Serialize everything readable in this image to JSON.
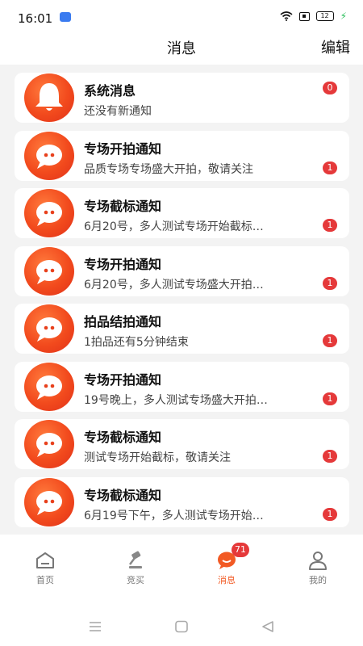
{
  "status": {
    "time": "16:01",
    "battery": "12"
  },
  "header": {
    "title": "消息",
    "edit": "编辑"
  },
  "messages": [
    {
      "title": "系统消息",
      "sub": "还没有新通知",
      "badge": "0",
      "icon": "bell-icon"
    },
    {
      "title": "专场开拍通知",
      "sub": "品质专场专场盛大开拍，敬请关注",
      "badge": "1",
      "icon": "chat-bubble-icon"
    },
    {
      "title": "专场截标通知",
      "sub": "6月20号，多人测试专场开始截标…",
      "badge": "1",
      "icon": "chat-bubble-icon"
    },
    {
      "title": "专场开拍通知",
      "sub": "6月20号，多人测试专场盛大开拍…",
      "badge": "1",
      "icon": "chat-bubble-icon"
    },
    {
      "title": "拍品结拍通知",
      "sub": "1拍品还有5分钟结束",
      "badge": "1",
      "icon": "chat-bubble-icon"
    },
    {
      "title": "专场开拍通知",
      "sub": "19号晚上，多人测试专场盛大开拍…",
      "badge": "1",
      "icon": "chat-bubble-icon"
    },
    {
      "title": "专场截标通知",
      "sub": "测试专场开始截标，敬请关注",
      "badge": "1",
      "icon": "chat-bubble-icon"
    },
    {
      "title": "专场截标通知",
      "sub": "6月19号下午，多人测试专场开始…",
      "badge": "1",
      "icon": "chat-bubble-icon"
    }
  ],
  "tabs": [
    {
      "label": "首页",
      "icon": "home-icon"
    },
    {
      "label": "竞买",
      "icon": "gavel-icon"
    },
    {
      "label": "消息",
      "icon": "message-icon",
      "badge": "71",
      "active": true
    },
    {
      "label": "我的",
      "icon": "person-icon"
    }
  ],
  "colors": {
    "accent": "#f25a24",
    "badge": "#e5393a"
  }
}
